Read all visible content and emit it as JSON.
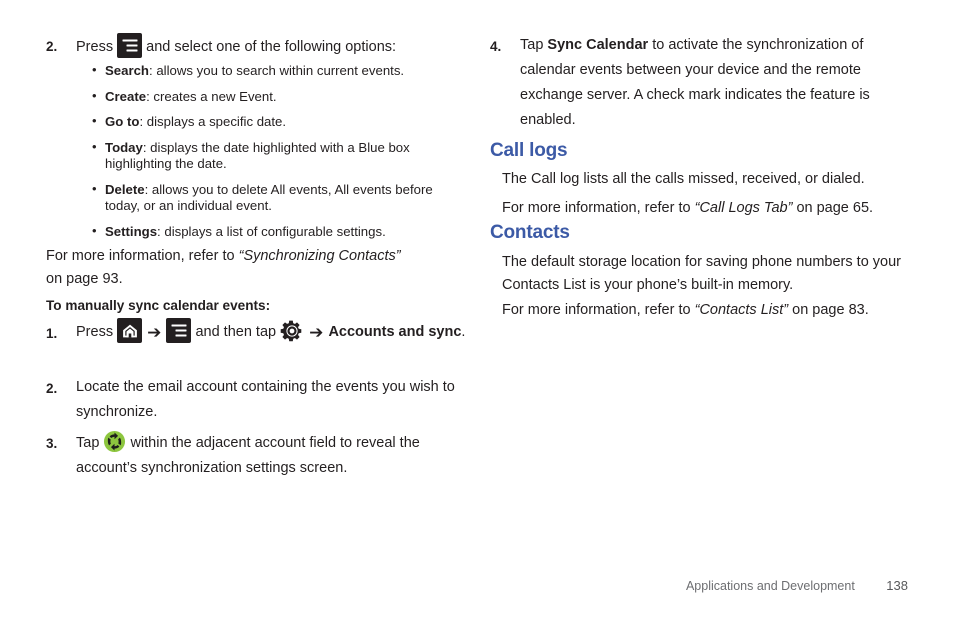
{
  "document": {
    "footer": {
      "section": "Applications and Development",
      "page_number": "138"
    },
    "colors": {
      "heading_blue": "#3c5aa6",
      "body_text": "#231f20",
      "icon_badge": "#231f20",
      "sync_green": "#8dc63f",
      "footer_text": "#6d6e71"
    }
  },
  "left_column": {
    "step2": {
      "number": "2.",
      "text_before_icon": "Press",
      "icon": "menu-icon",
      "text_after_icon": "and select one of the following options:"
    },
    "options": [
      {
        "term": "Search",
        "desc": ": allows you to search within current events."
      },
      {
        "term": "Create",
        "desc": ": creates a new Event."
      },
      {
        "term": "Go to",
        "desc": ": displays a specific date."
      },
      {
        "term": "Today",
        "desc": ": displays the date highlighted with a Blue box highlighting the date."
      },
      {
        "term": "Delete",
        "desc": ": allows you to delete All events, All events before today, or an individual event."
      },
      {
        "term": "Settings",
        "desc": ": displays a list of configurable settings."
      }
    ],
    "cross_reference": {
      "lead": "For more information, refer to",
      "title": "“Synchronizing Contacts”",
      "tail": "on page 93."
    },
    "subhead": "To manually sync calendar events:",
    "step1": {
      "number": "1.",
      "press_label": "Press",
      "home_icon": "home-icon",
      "arrow": "➔",
      "menu_icon": "menu-icon",
      "and_then_tap": "and then tap",
      "gear_icon": "gear-icon",
      "arrow2": "➔",
      "destination": "Accounts and sync",
      "period": "."
    },
    "step2b": {
      "number": "2.",
      "text": "Locate the email account containing the events you wish to synchronize."
    },
    "step3": {
      "number": "3.",
      "text_before_icon": "Tap",
      "icon": "sync-icon",
      "text_after_icon": "within the adjacent account field to reveal the account’s synchronization settings screen."
    }
  },
  "right_column": {
    "step4": {
      "number": "4.",
      "lead": "Tap",
      "bold_term": "Sync Calendar",
      "rest": "to activate the synchronization of calendar events between your device and the remote exchange server. A check mark indicates the feature is enabled."
    },
    "call_logs": {
      "heading": "Call logs",
      "body": "The Call log lists all the calls missed, received, or dialed.",
      "cross_reference": {
        "lead": "For more information, refer to",
        "title": "“Call Logs Tab”",
        "tail": "on page 65."
      }
    },
    "contacts": {
      "heading": "Contacts",
      "body": "The default storage location for saving phone numbers to your Contacts List is your phone’s built-in memory.",
      "cross_reference": {
        "lead": "For more information, refer to",
        "title": "“Contacts List”",
        "tail": "on page 83."
      }
    }
  }
}
